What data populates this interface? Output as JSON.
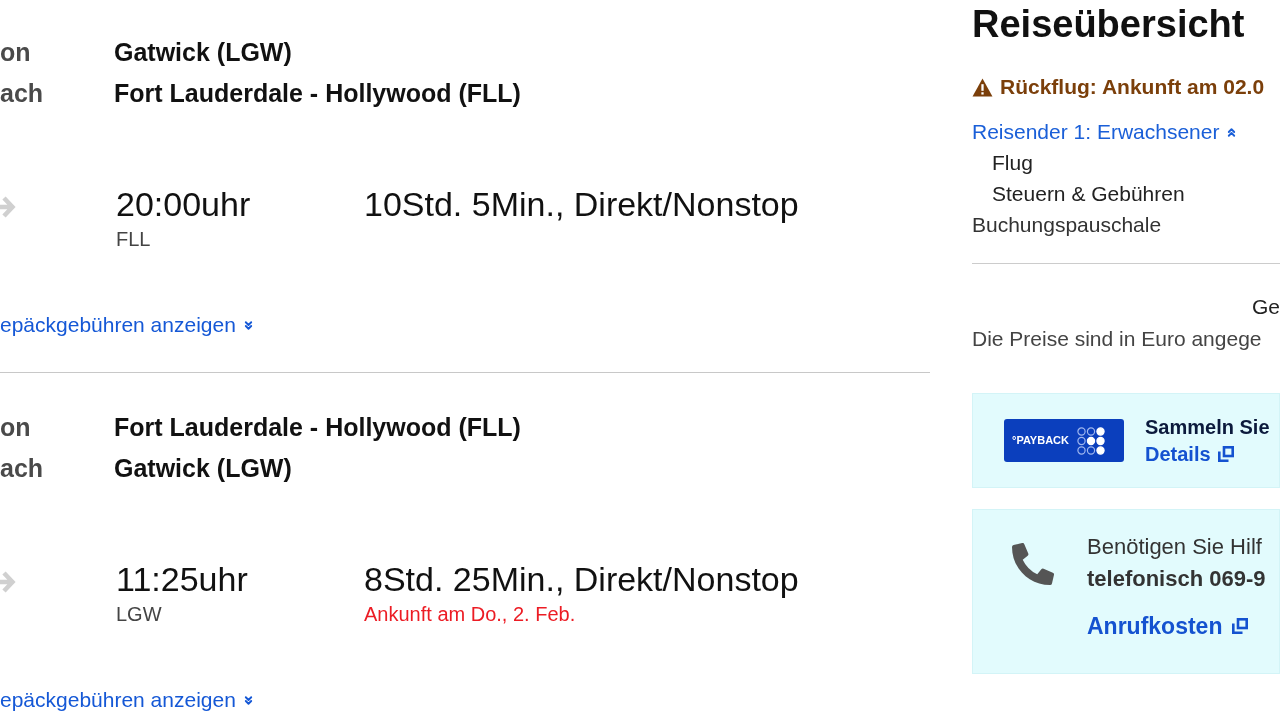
{
  "segments": [
    {
      "from_label": "on",
      "from": "Gatwick (LGW)",
      "to_label": "ach",
      "to": "Fort Lauderdale - Hollywood (FLL)",
      "time": "20:00uhr",
      "airport": "FLL",
      "duration": "10Std. 5Min., Direkt/Nonstop",
      "baggage_link": {
        "label": "epäckgebühren anzeigen",
        "expanded": false
      }
    },
    {
      "from_label": "on",
      "from": "Fort Lauderdale - Hollywood (FLL)",
      "to_label": "ach",
      "to": "Gatwick (LGW)",
      "time": "11:25uhr",
      "airport": "LGW",
      "duration": "8Std. 25Min., Direkt/Nonstop",
      "arrival_note": "Ankunft am Do., 2. Feb.",
      "baggage_link": {
        "label": "epäckgebühren anzeigen",
        "expanded": false
      }
    }
  ],
  "summary": {
    "title": "Reiseübersicht",
    "warning": "Rückflug: Ankunft am 02.0",
    "traveler": {
      "label": "Reisender 1: Erwachsener",
      "expanded": true,
      "items": [
        "Flug",
        "Steuern & Gebühren"
      ]
    },
    "booking_fee": "Buchungspauschale",
    "total_label": "Ge",
    "currency_note": "Die Preise sind in Euro angege"
  },
  "payback": {
    "logo_text": "°PAYBACK",
    "text": "Sammeln Sie",
    "link": "Details"
  },
  "help": {
    "question": "Benötigen Sie Hilf",
    "phone": "telefonisch 069-9",
    "link": "Anrufkosten"
  }
}
